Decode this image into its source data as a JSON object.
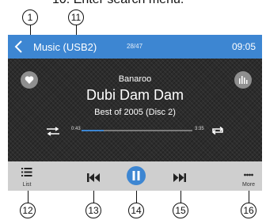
{
  "manual_caption": "10. Enter search menu.",
  "callouts": [
    "1",
    "11",
    "12",
    "13",
    "14",
    "15",
    "16"
  ],
  "topbar": {
    "title": "Music (USB2)",
    "track_count": "28/47",
    "clock": "09:05"
  },
  "now_playing": {
    "artist": "Banaroo",
    "song": "Dubi Dam Dam",
    "album": "Best of 2005 (Disc 2)"
  },
  "progress": {
    "elapsed": "0:43",
    "duration": "3:35",
    "fraction": 0.2
  },
  "bottombar": {
    "list_label": "List",
    "more_label": "More"
  },
  "colors": {
    "accent": "#3d86d2",
    "bottom_bar": "#cfcfcf",
    "main_bg": "#2c2c2c"
  },
  "icons": [
    "back-icon",
    "heart-icon",
    "equalizer-icon",
    "shuffle-icon",
    "repeat-icon",
    "list-icon",
    "previous-icon",
    "pause-icon",
    "next-icon",
    "more-icon"
  ]
}
